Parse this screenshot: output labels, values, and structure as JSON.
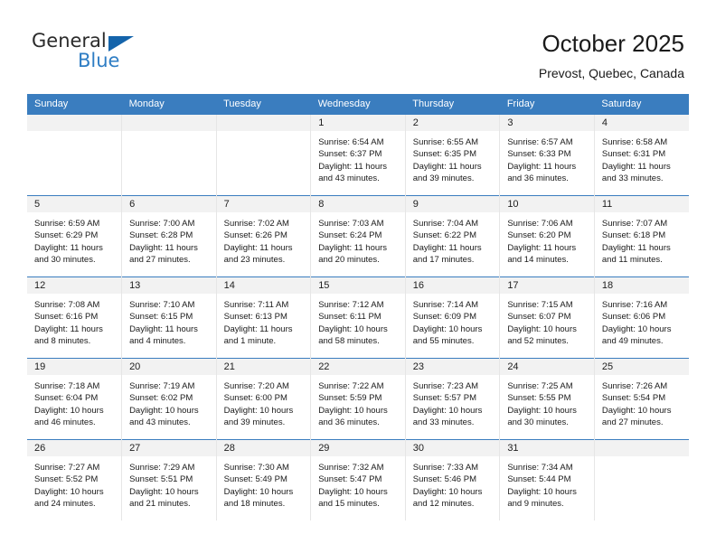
{
  "brand": {
    "name_part1": "General",
    "name_part2": "Blue",
    "flag_icon": "triangle-flag-icon",
    "accent_color": "#1464ab",
    "blue_text_color": "#2e7dc4"
  },
  "header": {
    "title": "October 2025",
    "subtitle": "Prevost, Quebec, Canada"
  },
  "calendar": {
    "header_bg_color": "#3a7dbf",
    "daynum_band_color": "#f2f2f2",
    "weekday_headers": [
      "Sunday",
      "Monday",
      "Tuesday",
      "Wednesday",
      "Thursday",
      "Friday",
      "Saturday"
    ],
    "weeks": [
      [
        {
          "day": "",
          "sunrise": "",
          "sunset": "",
          "daylight_line1": "",
          "daylight_line2": ""
        },
        {
          "day": "",
          "sunrise": "",
          "sunset": "",
          "daylight_line1": "",
          "daylight_line2": ""
        },
        {
          "day": "",
          "sunrise": "",
          "sunset": "",
          "daylight_line1": "",
          "daylight_line2": ""
        },
        {
          "day": "1",
          "sunrise": "Sunrise: 6:54 AM",
          "sunset": "Sunset: 6:37 PM",
          "daylight_line1": "Daylight: 11 hours",
          "daylight_line2": "and 43 minutes."
        },
        {
          "day": "2",
          "sunrise": "Sunrise: 6:55 AM",
          "sunset": "Sunset: 6:35 PM",
          "daylight_line1": "Daylight: 11 hours",
          "daylight_line2": "and 39 minutes."
        },
        {
          "day": "3",
          "sunrise": "Sunrise: 6:57 AM",
          "sunset": "Sunset: 6:33 PM",
          "daylight_line1": "Daylight: 11 hours",
          "daylight_line2": "and 36 minutes."
        },
        {
          "day": "4",
          "sunrise": "Sunrise: 6:58 AM",
          "sunset": "Sunset: 6:31 PM",
          "daylight_line1": "Daylight: 11 hours",
          "daylight_line2": "and 33 minutes."
        }
      ],
      [
        {
          "day": "5",
          "sunrise": "Sunrise: 6:59 AM",
          "sunset": "Sunset: 6:29 PM",
          "daylight_line1": "Daylight: 11 hours",
          "daylight_line2": "and 30 minutes."
        },
        {
          "day": "6",
          "sunrise": "Sunrise: 7:00 AM",
          "sunset": "Sunset: 6:28 PM",
          "daylight_line1": "Daylight: 11 hours",
          "daylight_line2": "and 27 minutes."
        },
        {
          "day": "7",
          "sunrise": "Sunrise: 7:02 AM",
          "sunset": "Sunset: 6:26 PM",
          "daylight_line1": "Daylight: 11 hours",
          "daylight_line2": "and 23 minutes."
        },
        {
          "day": "8",
          "sunrise": "Sunrise: 7:03 AM",
          "sunset": "Sunset: 6:24 PM",
          "daylight_line1": "Daylight: 11 hours",
          "daylight_line2": "and 20 minutes."
        },
        {
          "day": "9",
          "sunrise": "Sunrise: 7:04 AM",
          "sunset": "Sunset: 6:22 PM",
          "daylight_line1": "Daylight: 11 hours",
          "daylight_line2": "and 17 minutes."
        },
        {
          "day": "10",
          "sunrise": "Sunrise: 7:06 AM",
          "sunset": "Sunset: 6:20 PM",
          "daylight_line1": "Daylight: 11 hours",
          "daylight_line2": "and 14 minutes."
        },
        {
          "day": "11",
          "sunrise": "Sunrise: 7:07 AM",
          "sunset": "Sunset: 6:18 PM",
          "daylight_line1": "Daylight: 11 hours",
          "daylight_line2": "and 11 minutes."
        }
      ],
      [
        {
          "day": "12",
          "sunrise": "Sunrise: 7:08 AM",
          "sunset": "Sunset: 6:16 PM",
          "daylight_line1": "Daylight: 11 hours",
          "daylight_line2": "and 8 minutes."
        },
        {
          "day": "13",
          "sunrise": "Sunrise: 7:10 AM",
          "sunset": "Sunset: 6:15 PM",
          "daylight_line1": "Daylight: 11 hours",
          "daylight_line2": "and 4 minutes."
        },
        {
          "day": "14",
          "sunrise": "Sunrise: 7:11 AM",
          "sunset": "Sunset: 6:13 PM",
          "daylight_line1": "Daylight: 11 hours",
          "daylight_line2": "and 1 minute."
        },
        {
          "day": "15",
          "sunrise": "Sunrise: 7:12 AM",
          "sunset": "Sunset: 6:11 PM",
          "daylight_line1": "Daylight: 10 hours",
          "daylight_line2": "and 58 minutes."
        },
        {
          "day": "16",
          "sunrise": "Sunrise: 7:14 AM",
          "sunset": "Sunset: 6:09 PM",
          "daylight_line1": "Daylight: 10 hours",
          "daylight_line2": "and 55 minutes."
        },
        {
          "day": "17",
          "sunrise": "Sunrise: 7:15 AM",
          "sunset": "Sunset: 6:07 PM",
          "daylight_line1": "Daylight: 10 hours",
          "daylight_line2": "and 52 minutes."
        },
        {
          "day": "18",
          "sunrise": "Sunrise: 7:16 AM",
          "sunset": "Sunset: 6:06 PM",
          "daylight_line1": "Daylight: 10 hours",
          "daylight_line2": "and 49 minutes."
        }
      ],
      [
        {
          "day": "19",
          "sunrise": "Sunrise: 7:18 AM",
          "sunset": "Sunset: 6:04 PM",
          "daylight_line1": "Daylight: 10 hours",
          "daylight_line2": "and 46 minutes."
        },
        {
          "day": "20",
          "sunrise": "Sunrise: 7:19 AM",
          "sunset": "Sunset: 6:02 PM",
          "daylight_line1": "Daylight: 10 hours",
          "daylight_line2": "and 43 minutes."
        },
        {
          "day": "21",
          "sunrise": "Sunrise: 7:20 AM",
          "sunset": "Sunset: 6:00 PM",
          "daylight_line1": "Daylight: 10 hours",
          "daylight_line2": "and 39 minutes."
        },
        {
          "day": "22",
          "sunrise": "Sunrise: 7:22 AM",
          "sunset": "Sunset: 5:59 PM",
          "daylight_line1": "Daylight: 10 hours",
          "daylight_line2": "and 36 minutes."
        },
        {
          "day": "23",
          "sunrise": "Sunrise: 7:23 AM",
          "sunset": "Sunset: 5:57 PM",
          "daylight_line1": "Daylight: 10 hours",
          "daylight_line2": "and 33 minutes."
        },
        {
          "day": "24",
          "sunrise": "Sunrise: 7:25 AM",
          "sunset": "Sunset: 5:55 PM",
          "daylight_line1": "Daylight: 10 hours",
          "daylight_line2": "and 30 minutes."
        },
        {
          "day": "25",
          "sunrise": "Sunrise: 7:26 AM",
          "sunset": "Sunset: 5:54 PM",
          "daylight_line1": "Daylight: 10 hours",
          "daylight_line2": "and 27 minutes."
        }
      ],
      [
        {
          "day": "26",
          "sunrise": "Sunrise: 7:27 AM",
          "sunset": "Sunset: 5:52 PM",
          "daylight_line1": "Daylight: 10 hours",
          "daylight_line2": "and 24 minutes."
        },
        {
          "day": "27",
          "sunrise": "Sunrise: 7:29 AM",
          "sunset": "Sunset: 5:51 PM",
          "daylight_line1": "Daylight: 10 hours",
          "daylight_line2": "and 21 minutes."
        },
        {
          "day": "28",
          "sunrise": "Sunrise: 7:30 AM",
          "sunset": "Sunset: 5:49 PM",
          "daylight_line1": "Daylight: 10 hours",
          "daylight_line2": "and 18 minutes."
        },
        {
          "day": "29",
          "sunrise": "Sunrise: 7:32 AM",
          "sunset": "Sunset: 5:47 PM",
          "daylight_line1": "Daylight: 10 hours",
          "daylight_line2": "and 15 minutes."
        },
        {
          "day": "30",
          "sunrise": "Sunrise: 7:33 AM",
          "sunset": "Sunset: 5:46 PM",
          "daylight_line1": "Daylight: 10 hours",
          "daylight_line2": "and 12 minutes."
        },
        {
          "day": "31",
          "sunrise": "Sunrise: 7:34 AM",
          "sunset": "Sunset: 5:44 PM",
          "daylight_line1": "Daylight: 10 hours",
          "daylight_line2": "and 9 minutes."
        },
        {
          "day": "",
          "sunrise": "",
          "sunset": "",
          "daylight_line1": "",
          "daylight_line2": ""
        }
      ]
    ]
  }
}
